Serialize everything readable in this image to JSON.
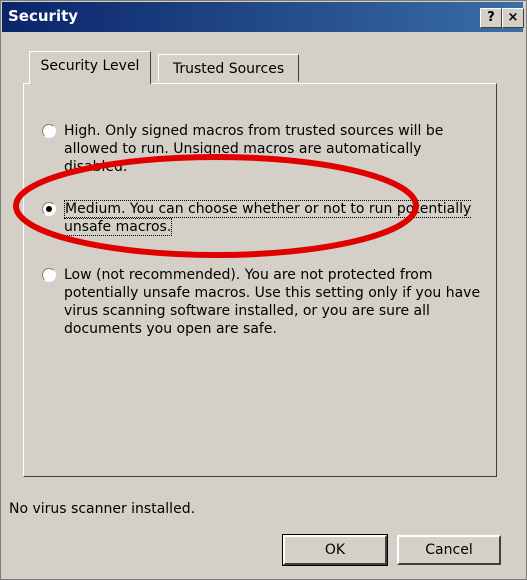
{
  "window": {
    "title": "Security",
    "help_glyph": "?",
    "close_glyph": "×"
  },
  "tabs": [
    {
      "label": "Security Level",
      "active": true
    },
    {
      "label": "Trusted Sources",
      "active": false
    }
  ],
  "options": {
    "high": {
      "text": "High. Only signed macros from trusted sources will be allowed to run. Unsigned macros are automatically disabled.",
      "selected": false
    },
    "medium": {
      "text": "Medium. You can choose whether or not to run potentially unsafe macros.",
      "selected": true
    },
    "low": {
      "text": "Low (not recommended). You are not protected from potentially unsafe macros. Use this setting only if you have virus scanning software installed, or you are sure all documents you open are safe.",
      "selected": false
    }
  },
  "status": "No virus scanner installed.",
  "buttons": {
    "ok": "OK",
    "cancel": "Cancel"
  },
  "colors": {
    "title_bar": "#0a246a",
    "dialog_face": "#d4d0c8",
    "annotation_ring": "#e00000"
  }
}
